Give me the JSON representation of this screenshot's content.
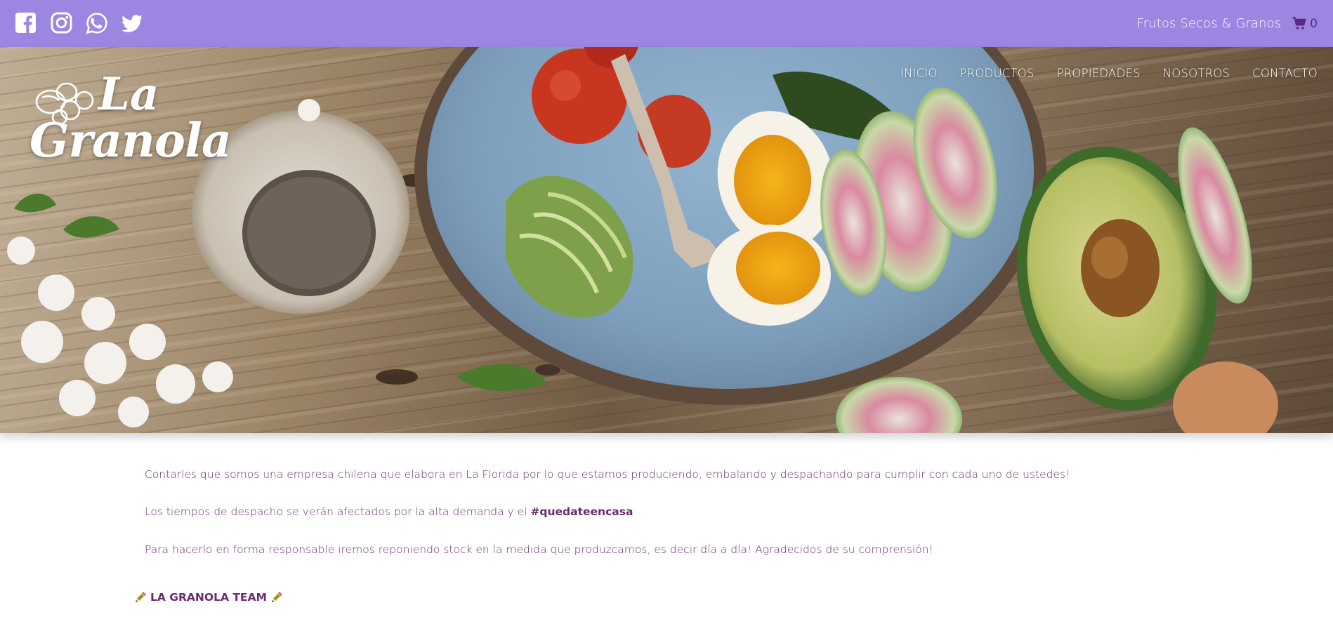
{
  "topbar": {
    "social": [
      {
        "name": "facebook-icon"
      },
      {
        "name": "instagram-icon"
      },
      {
        "name": "whatsapp-icon"
      },
      {
        "name": "twitter-icon"
      }
    ],
    "tagline": "Frutos Secos & Granos",
    "cart_count": "0",
    "cart_icon": "shopping-cart-icon"
  },
  "hero": {
    "logo": {
      "line1": "La",
      "line2": "Granola"
    },
    "nav": [
      "INICIO",
      "PRODUCTOS",
      "PROPIEDADES",
      "NOSOTROS",
      "CONTACTO"
    ]
  },
  "content": {
    "p1": "Contarles que somos una empresa chilena que elabora en La Florida por lo que estamos produciendo, embalando y despachando para cumplir con cada uno de ustedes!",
    "p2_text": "Los tiempos de despacho se verán afectados por la alta demanda y el ",
    "p2_hashtag": "#quedateencasa",
    "p3": "Para hacerlo en forma responsable iremos reponiendo stock en la medida que produzcamos, es decir día a día! Agradecidos de su comprensión!",
    "team": "LA GRANOLA TEAM",
    "team_icon": "pencil-emoji-icon"
  },
  "colors": {
    "topbar_bg": "#9c86e2",
    "text_purple": "#6a2c6e",
    "cart_purple": "#5b2a86"
  }
}
